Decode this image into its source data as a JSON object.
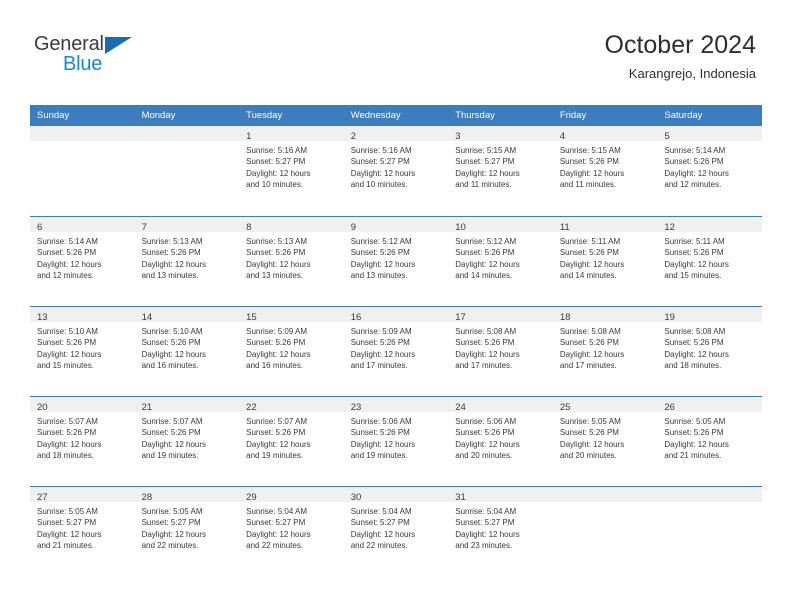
{
  "brand": {
    "line1": "General",
    "line2": "Blue",
    "triangle_color": "#1a6cb5"
  },
  "header": {
    "title": "October 2024",
    "subtitle": "Karangrejo, Indonesia"
  },
  "theme": {
    "header_bar": "#3d7cbe",
    "day_band": "#f0f0f0",
    "text": "#3a3a3a",
    "brand_blue": "#1a86d9"
  },
  "calendar": {
    "weekday_headers": [
      "Sunday",
      "Monday",
      "Tuesday",
      "Wednesday",
      "Thursday",
      "Friday",
      "Saturday"
    ],
    "weeks": [
      [
        {
          "day": "",
          "lines": []
        },
        {
          "day": "",
          "lines": []
        },
        {
          "day": "1",
          "lines": [
            "Sunrise: 5:16 AM",
            "Sunset: 5:27 PM",
            "Daylight: 12 hours",
            "and 10 minutes."
          ]
        },
        {
          "day": "2",
          "lines": [
            "Sunrise: 5:16 AM",
            "Sunset: 5:27 PM",
            "Daylight: 12 hours",
            "and 10 minutes."
          ]
        },
        {
          "day": "3",
          "lines": [
            "Sunrise: 5:15 AM",
            "Sunset: 5:27 PM",
            "Daylight: 12 hours",
            "and 11 minutes."
          ]
        },
        {
          "day": "4",
          "lines": [
            "Sunrise: 5:15 AM",
            "Sunset: 5:26 PM",
            "Daylight: 12 hours",
            "and 11 minutes."
          ]
        },
        {
          "day": "5",
          "lines": [
            "Sunrise: 5:14 AM",
            "Sunset: 5:26 PM",
            "Daylight: 12 hours",
            "and 12 minutes."
          ]
        }
      ],
      [
        {
          "day": "6",
          "lines": [
            "Sunrise: 5:14 AM",
            "Sunset: 5:26 PM",
            "Daylight: 12 hours",
            "and 12 minutes."
          ]
        },
        {
          "day": "7",
          "lines": [
            "Sunrise: 5:13 AM",
            "Sunset: 5:26 PM",
            "Daylight: 12 hours",
            "and 13 minutes."
          ]
        },
        {
          "day": "8",
          "lines": [
            "Sunrise: 5:13 AM",
            "Sunset: 5:26 PM",
            "Daylight: 12 hours",
            "and 13 minutes."
          ]
        },
        {
          "day": "9",
          "lines": [
            "Sunrise: 5:12 AM",
            "Sunset: 5:26 PM",
            "Daylight: 12 hours",
            "and 13 minutes."
          ]
        },
        {
          "day": "10",
          "lines": [
            "Sunrise: 5:12 AM",
            "Sunset: 5:26 PM",
            "Daylight: 12 hours",
            "and 14 minutes."
          ]
        },
        {
          "day": "11",
          "lines": [
            "Sunrise: 5:11 AM",
            "Sunset: 5:26 PM",
            "Daylight: 12 hours",
            "and 14 minutes."
          ]
        },
        {
          "day": "12",
          "lines": [
            "Sunrise: 5:11 AM",
            "Sunset: 5:26 PM",
            "Daylight: 12 hours",
            "and 15 minutes."
          ]
        }
      ],
      [
        {
          "day": "13",
          "lines": [
            "Sunrise: 5:10 AM",
            "Sunset: 5:26 PM",
            "Daylight: 12 hours",
            "and 15 minutes."
          ]
        },
        {
          "day": "14",
          "lines": [
            "Sunrise: 5:10 AM",
            "Sunset: 5:26 PM",
            "Daylight: 12 hours",
            "and 16 minutes."
          ]
        },
        {
          "day": "15",
          "lines": [
            "Sunrise: 5:09 AM",
            "Sunset: 5:26 PM",
            "Daylight: 12 hours",
            "and 16 minutes."
          ]
        },
        {
          "day": "16",
          "lines": [
            "Sunrise: 5:09 AM",
            "Sunset: 5:26 PM",
            "Daylight: 12 hours",
            "and 17 minutes."
          ]
        },
        {
          "day": "17",
          "lines": [
            "Sunrise: 5:08 AM",
            "Sunset: 5:26 PM",
            "Daylight: 12 hours",
            "and 17 minutes."
          ]
        },
        {
          "day": "18",
          "lines": [
            "Sunrise: 5:08 AM",
            "Sunset: 5:26 PM",
            "Daylight: 12 hours",
            "and 17 minutes."
          ]
        },
        {
          "day": "19",
          "lines": [
            "Sunrise: 5:08 AM",
            "Sunset: 5:26 PM",
            "Daylight: 12 hours",
            "and 18 minutes."
          ]
        }
      ],
      [
        {
          "day": "20",
          "lines": [
            "Sunrise: 5:07 AM",
            "Sunset: 5:26 PM",
            "Daylight: 12 hours",
            "and 18 minutes."
          ]
        },
        {
          "day": "21",
          "lines": [
            "Sunrise: 5:07 AM",
            "Sunset: 5:26 PM",
            "Daylight: 12 hours",
            "and 19 minutes."
          ]
        },
        {
          "day": "22",
          "lines": [
            "Sunrise: 5:07 AM",
            "Sunset: 5:26 PM",
            "Daylight: 12 hours",
            "and 19 minutes."
          ]
        },
        {
          "day": "23",
          "lines": [
            "Sunrise: 5:06 AM",
            "Sunset: 5:26 PM",
            "Daylight: 12 hours",
            "and 19 minutes."
          ]
        },
        {
          "day": "24",
          "lines": [
            "Sunrise: 5:06 AM",
            "Sunset: 5:26 PM",
            "Daylight: 12 hours",
            "and 20 minutes."
          ]
        },
        {
          "day": "25",
          "lines": [
            "Sunrise: 5:05 AM",
            "Sunset: 5:26 PM",
            "Daylight: 12 hours",
            "and 20 minutes."
          ]
        },
        {
          "day": "26",
          "lines": [
            "Sunrise: 5:05 AM",
            "Sunset: 5:26 PM",
            "Daylight: 12 hours",
            "and 21 minutes."
          ]
        }
      ],
      [
        {
          "day": "27",
          "lines": [
            "Sunrise: 5:05 AM",
            "Sunset: 5:27 PM",
            "Daylight: 12 hours",
            "and 21 minutes."
          ]
        },
        {
          "day": "28",
          "lines": [
            "Sunrise: 5:05 AM",
            "Sunset: 5:27 PM",
            "Daylight: 12 hours",
            "and 22 minutes."
          ]
        },
        {
          "day": "29",
          "lines": [
            "Sunrise: 5:04 AM",
            "Sunset: 5:27 PM",
            "Daylight: 12 hours",
            "and 22 minutes."
          ]
        },
        {
          "day": "30",
          "lines": [
            "Sunrise: 5:04 AM",
            "Sunset: 5:27 PM",
            "Daylight: 12 hours",
            "and 22 minutes."
          ]
        },
        {
          "day": "31",
          "lines": [
            "Sunrise: 5:04 AM",
            "Sunset: 5:27 PM",
            "Daylight: 12 hours",
            "and 23 minutes."
          ]
        },
        {
          "day": "",
          "lines": []
        },
        {
          "day": "",
          "lines": []
        }
      ]
    ]
  }
}
